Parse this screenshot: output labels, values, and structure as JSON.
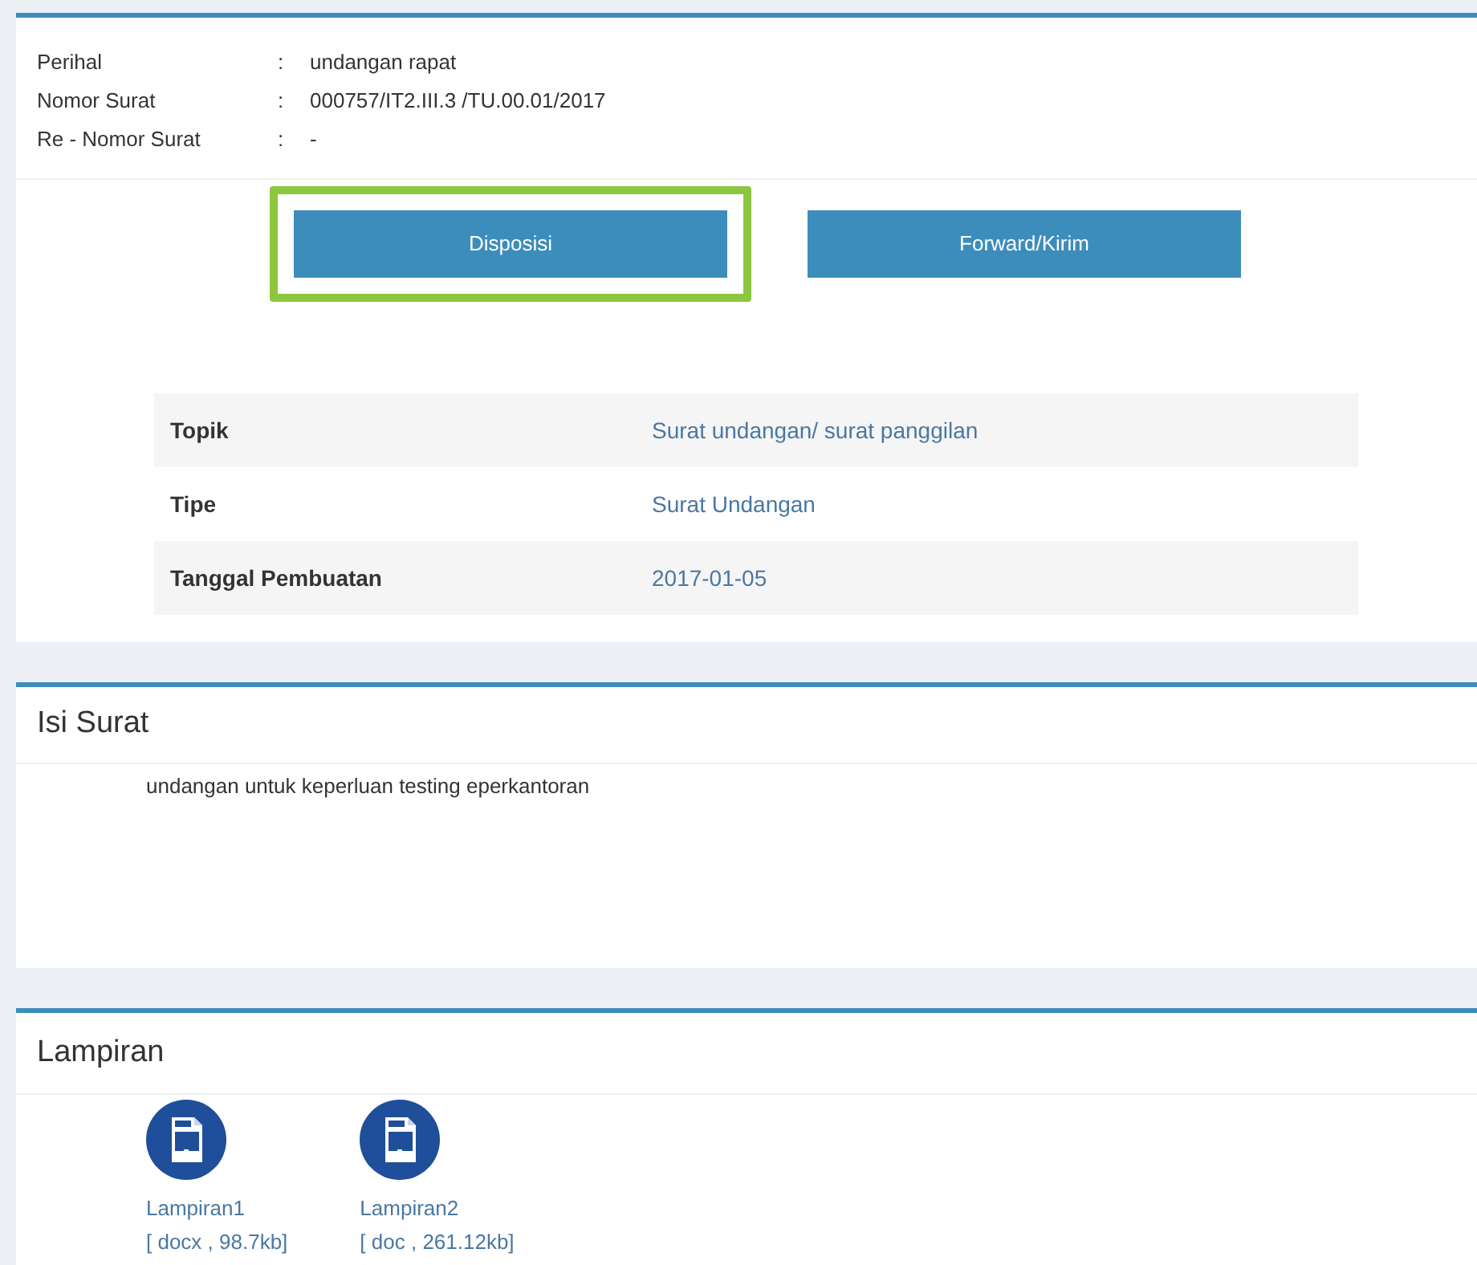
{
  "info": [
    {
      "label": "Perihal",
      "separator": ":",
      "value": "undangan rapat"
    },
    {
      "label": "Nomor Surat",
      "separator": ":",
      "value": "000757/IT2.III.3 /TU.00.01/2017"
    },
    {
      "label": "Re - Nomor Surat",
      "separator": ":",
      "value": "-"
    }
  ],
  "buttons": [
    {
      "label": "Disposisi",
      "highlighted": true
    },
    {
      "label": "Forward/Kirim",
      "highlighted": false
    }
  ],
  "details": [
    {
      "label": "Topik",
      "value": "Surat undangan/ surat panggilan"
    },
    {
      "label": "Tipe",
      "value": "Surat Undangan"
    },
    {
      "label": "Tanggal Pembuatan",
      "value": "2017-01-05"
    }
  ],
  "isi_surat": {
    "title": "Isi Surat",
    "body": "undangan untuk keperluan testing eperkantoran"
  },
  "lampiran": {
    "title": "Lampiran",
    "files": [
      {
        "name": "Lampiran1",
        "meta": "[ docx , 98.7kb]"
      },
      {
        "name": "Lampiran2",
        "meta": "[ doc , 261.12kb]"
      }
    ]
  }
}
